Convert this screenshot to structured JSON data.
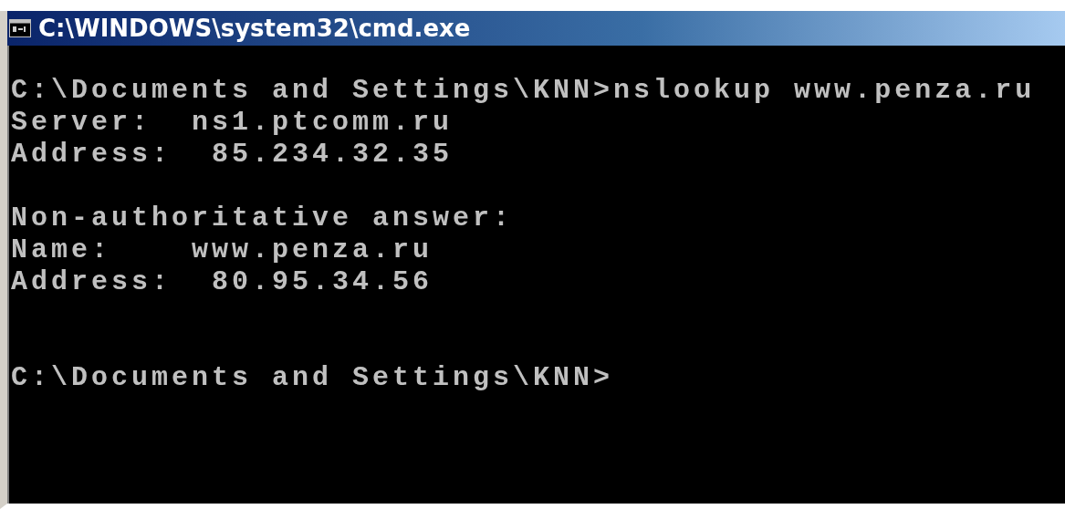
{
  "window": {
    "title": "C:\\WINDOWS\\system32\\cmd.exe"
  },
  "console": {
    "blocks": [
      [
        "C:\\Documents and Settings\\KNN>nslookup www.penza.ru",
        "Server:  ns1.ptcomm.ru",
        "Address:  85.234.32.35"
      ],
      [
        "Non-authoritative answer:",
        "Name:    www.penza.ru",
        "Address:  80.95.34.56"
      ],
      [
        "C:\\Documents and Settings\\KNN>"
      ]
    ]
  }
}
